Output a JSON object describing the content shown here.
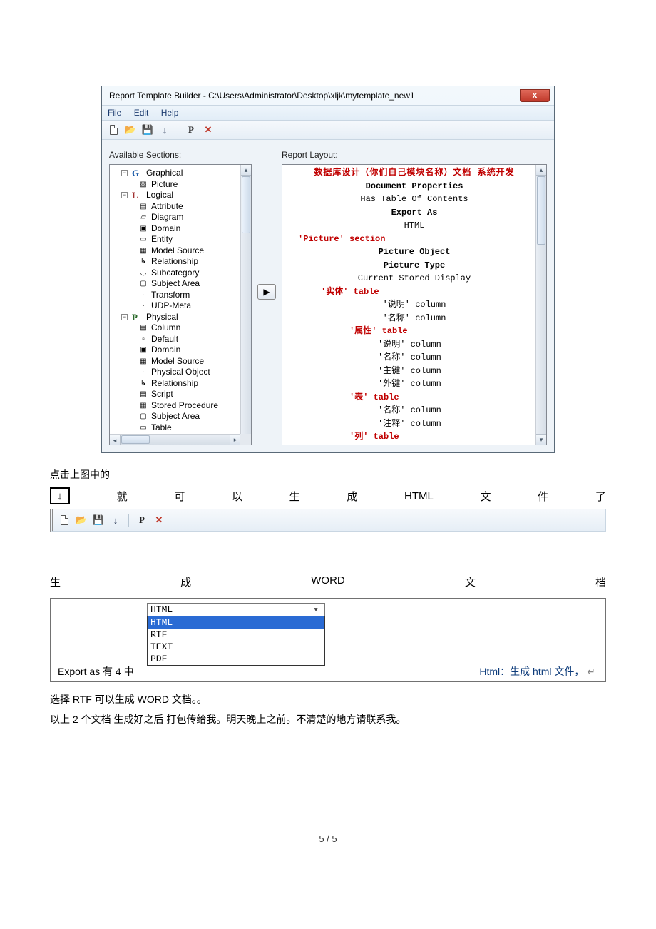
{
  "window": {
    "title": "Report Template Builder - C:\\Users\\Administrator\\Desktop\\xljk\\mytemplate_new1",
    "menu": {
      "file": "File",
      "edit": "Edit",
      "help": "Help"
    },
    "left_label": "Available Sections:",
    "right_label": "Report Layout:",
    "tree": {
      "graphical": "Graphical",
      "picture": "Picture",
      "logical": "Logical",
      "attribute": "Attribute",
      "diagram": "Diagram",
      "domain": "Domain",
      "entity": "Entity",
      "model_source": "Model Source",
      "relationship": "Relationship",
      "subcategory": "Subcategory",
      "subject_area": "Subject Area",
      "transform": "Transform",
      "udp_meta": "UDP-Meta",
      "physical": "Physical",
      "column": "Column",
      "default": "Default",
      "domain2": "Domain",
      "model_source2": "Model Source",
      "physical_object": "Physical Object",
      "relationship2": "Relationship",
      "script": "Script",
      "stored_procedure": "Stored Procedure",
      "subject_area2": "Subject Area",
      "table": "Table"
    },
    "layout": {
      "title": "数据库设计（你们自己模块名称）文档 系统开发",
      "doc_props": "Document Properties",
      "has_toc": "Has Table Of Contents",
      "export_as": "Export As",
      "html": "HTML",
      "picture_section": "'Picture' section",
      "picture_object": "Picture Object",
      "picture_type": "Picture Type",
      "current_stored": "Current Stored Display",
      "entity_table": "'实体' table",
      "col_desc": "'说明' column",
      "col_name": "'名称' column",
      "attr_table": "'属性' table",
      "col_desc2": "'说明' column",
      "col_name2": "'名称' column",
      "col_pk": "'主键' column",
      "col_fk": "'外键' column",
      "table_table": "'表' table",
      "col_name3": "'名称' column",
      "col_comment": "'注释' column",
      "col_table": "'列' table"
    }
  },
  "para1": "点击上图中的",
  "inline": {
    "w1": "就",
    "w2": "可",
    "w3": "以",
    "w4": "生",
    "w5": "成",
    "w6": "HTML",
    "w7": "文",
    "w8": "件",
    "w9": "了"
  },
  "spread_word": {
    "c1": "生",
    "c2": "成",
    "c3": "WORD",
    "c4": "文",
    "c5": "档"
  },
  "export": {
    "left_text": "Export as  有 4 中",
    "field_value": "HTML",
    "options": [
      "HTML",
      "RTF",
      "TEXT",
      "PDF"
    ],
    "right_text": "Html：生成 html 文件，",
    "right_arrow": "↵"
  },
  "para2": "选择 RTF 可以生成 WORD 文档。。",
  "para3": "以上 2 个文档 生成好之后 打包传给我。明天晚上之前。不清楚的地方请联系我。",
  "footer": "5 / 5"
}
